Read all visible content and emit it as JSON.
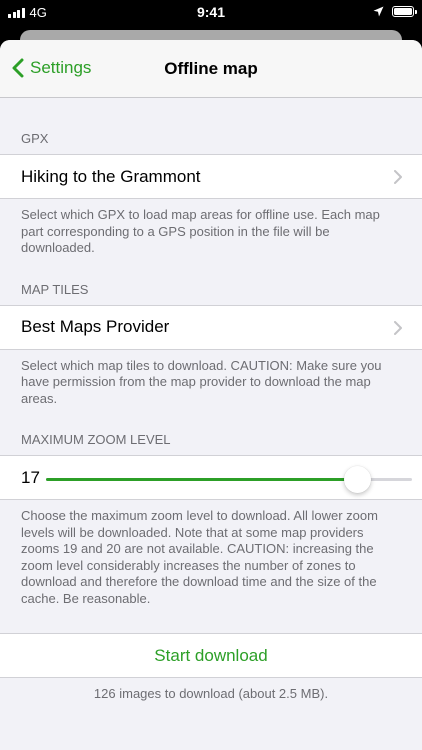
{
  "status_bar": {
    "carrier": "4G",
    "time": "9:41"
  },
  "navbar": {
    "back_label": "Settings",
    "title": "Offline map"
  },
  "gpx": {
    "header": "GPX",
    "selected": "Hiking to the Grammont",
    "footer": "Select which GPX to load map areas for offline use. Each map part corresponding to a GPS position in the file will be downloaded."
  },
  "map_tiles": {
    "header": "MAP TILES",
    "selected": "Best Maps Provider",
    "footer": "Select which map tiles to download. CAUTION: Make sure you have permission from the map provider to download the map areas."
  },
  "zoom": {
    "header": "MAXIMUM ZOOM LEVEL",
    "value": "17",
    "min": 0,
    "max": 20,
    "footer": "Choose the maximum zoom level to download. All lower zoom levels will be downloaded. Note that at some map providers zooms 19 and 20 are not available. CAUTION: increasing the zoom level considerably increases the number of zones to download and therefore the download time and the size of the cache. Be reasonable."
  },
  "download": {
    "button_label": "Start download",
    "footer": "126 images to download (about 2.5 MB)."
  },
  "colors": {
    "accent": "#2c9f27"
  }
}
